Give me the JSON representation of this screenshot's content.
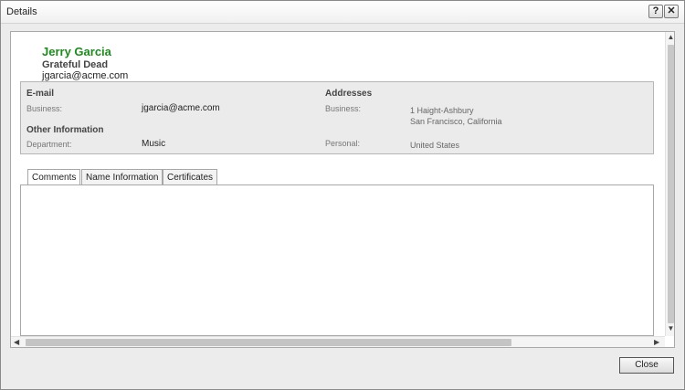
{
  "window": {
    "title": "Details",
    "help_label": "?",
    "close_label": "✕"
  },
  "contact": {
    "name": "Jerry Garcia",
    "company": "Grateful Dead",
    "email": "jgarcia@acme.com"
  },
  "email_section": {
    "heading": "E-mail",
    "business_label": "Business:",
    "business_value": "jgarcia@acme.com"
  },
  "other_section": {
    "heading": "Other Information",
    "department_label": "Department:",
    "department_value": "Music"
  },
  "addresses_section": {
    "heading": "Addresses",
    "business_label": "Business:",
    "business_line1": "1 Haight-Ashbury",
    "business_line2": "San Francisco, California",
    "personal_label": "Personal:",
    "personal_value": "United States"
  },
  "tabs": [
    {
      "label": "Comments"
    },
    {
      "label": "Name Information"
    },
    {
      "label": "Certificates"
    }
  ],
  "footer": {
    "close_label": "Close"
  },
  "icons": {
    "scroll_up": "chevron-up-icon",
    "scroll_down": "chevron-down-icon",
    "scroll_left": "chevron-left-icon",
    "scroll_right": "chevron-right-icon"
  }
}
